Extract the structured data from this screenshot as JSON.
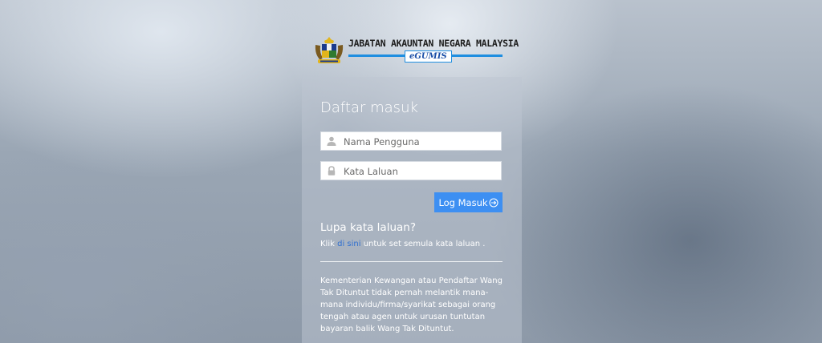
{
  "header": {
    "agency_name": "JABATAN AKAUNTAN NEGARA MALAYSIA",
    "system_name": "eGUMIS"
  },
  "login": {
    "title": "Daftar masuk",
    "username_placeholder": "Nama Pengguna",
    "password_placeholder": "Kata Laluan",
    "submit_label": "Log Masuk"
  },
  "forgot": {
    "title": "Lupa kata laluan?",
    "prefix": "Klik",
    "link_text": "di sini",
    "suffix": "untuk set semula kata laluan ."
  },
  "notice": {
    "text": "Kementerian Kewangan atau Pendaftar Wang Tak Dituntut tidak pernah melantik mana-mana individu/firma/syarikat sebagai orang tengah atau agen untuk urusan tuntutan bayaran balik Wang Tak Dituntut."
  },
  "colors": {
    "accent": "#3d8ff2",
    "link": "#2f6fd0",
    "brand_bar": "#1f8ee0"
  },
  "icons": {
    "crest": "coat-of-arms-icon",
    "username": "user-icon",
    "password": "lock-icon",
    "submit": "arrow-circle-right-icon"
  }
}
